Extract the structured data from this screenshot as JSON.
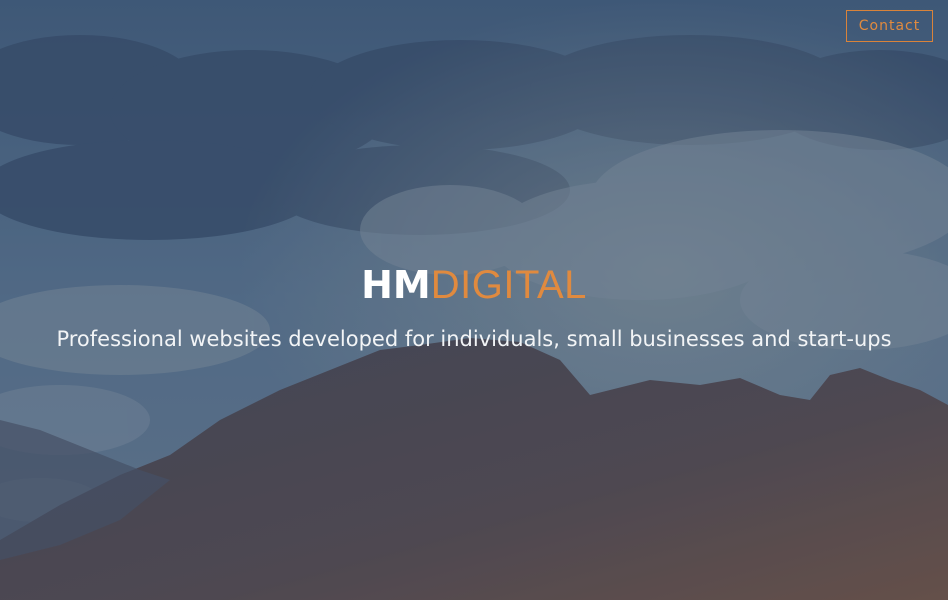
{
  "nav": {
    "contact_label": "Contact"
  },
  "hero": {
    "brand_part1": "HM",
    "brand_part2": "DIGITAL",
    "tagline": "Professional websites developed for individuals, small businesses and start-ups"
  },
  "colors": {
    "accent": "#e08a3f",
    "text": "#ffffff",
    "overlay": "#3f5a78"
  }
}
